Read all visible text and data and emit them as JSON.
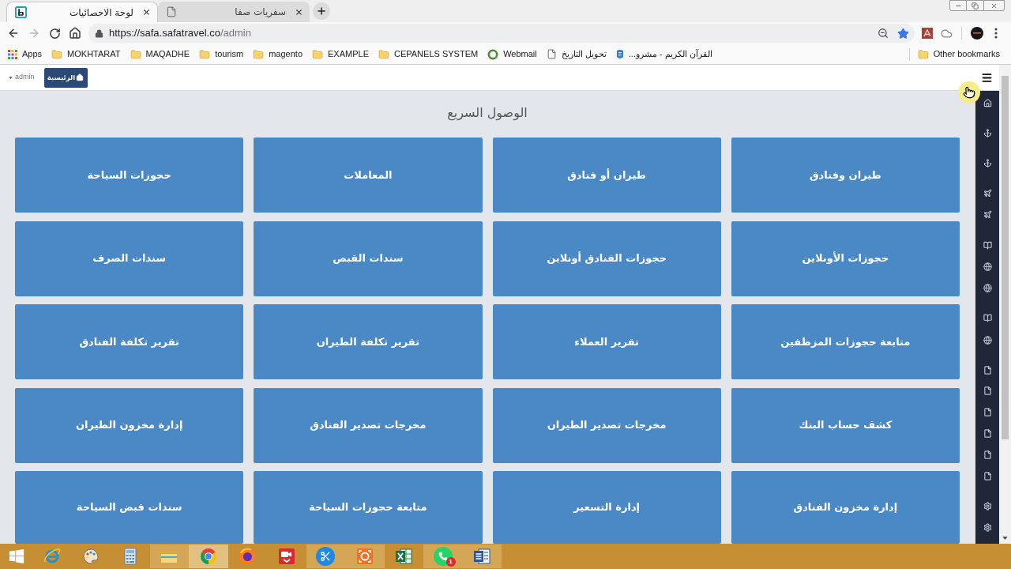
{
  "browser": {
    "tabs": [
      {
        "title": "سفريات صفا",
        "kind": "page",
        "selected": false
      },
      {
        "title": "لوحة الاحصائيات",
        "kind": "logo",
        "selected": true
      }
    ],
    "toolbar": {
      "back": {
        "disabled": false
      },
      "forward": {
        "disabled": true
      },
      "url": {
        "host": "https://safa.safatravel.co",
        "path": "/admin"
      },
      "bookmarked": true
    },
    "bookmarks": [
      {
        "label": "القرآن الكريم - مشرو...",
        "kind": "shield"
      },
      {
        "label": "تحويل التاريخ",
        "kind": "page"
      },
      {
        "label": "Webmail",
        "kind": "webmail"
      },
      {
        "label": "CEPANELS SYSTEM",
        "kind": "folder"
      },
      {
        "label": "EXAMPLE",
        "kind": "folder"
      },
      {
        "label": "magento",
        "kind": "folder"
      },
      {
        "label": "tourism",
        "kind": "folder"
      },
      {
        "label": "MAQADHE",
        "kind": "folder"
      },
      {
        "label": "MOKHTARAT",
        "kind": "folder"
      },
      {
        "label": "Apps",
        "kind": "apps"
      }
    ],
    "other_bookmarks": {
      "label": "Other bookmarks"
    }
  },
  "header": {
    "user": "admin",
    "home_button": "الرئيسية"
  },
  "quick_access": {
    "title": "الوصول السريع",
    "tiles": [
      "طيران وفنادق",
      "طيران أو فنادق",
      "المعاملات",
      "حجوزات السياحة",
      "حجوزات الأونلاين",
      "حجوزات الفنادق أونلاين",
      "سندات القبض",
      "سندات الصرف",
      "متابعة حجوزات المزظفين",
      "تقرير العملاء",
      "تقرير تكلفة الطيران",
      "تقرير تكلفة الفنادق",
      "كشف حساب البنك",
      "مخرجات تصدير الطيران",
      "مخرجات تصدير الفنادق",
      "إدارة مخزون الطيران",
      "إدارة مخزون الفنادق",
      "إدارة التسعير",
      "متابعة حجوزات السياحة",
      "سندات قبض السياحة"
    ]
  },
  "taskbar": {
    "apps": [
      {
        "running": false,
        "active": false
      },
      {
        "running": false,
        "active": false
      },
      {
        "running": false,
        "active": false
      },
      {
        "running": true,
        "active": false
      },
      {
        "running": true,
        "active": true
      },
      {
        "running": false,
        "active": false
      },
      {
        "running": false,
        "active": false
      },
      {
        "running": true,
        "active": false
      },
      {
        "running": true,
        "active": false
      },
      {
        "running": false,
        "active": false
      },
      {
        "running": true,
        "active": false,
        "badge": "1"
      },
      {
        "running": true,
        "active": false
      }
    ]
  }
}
